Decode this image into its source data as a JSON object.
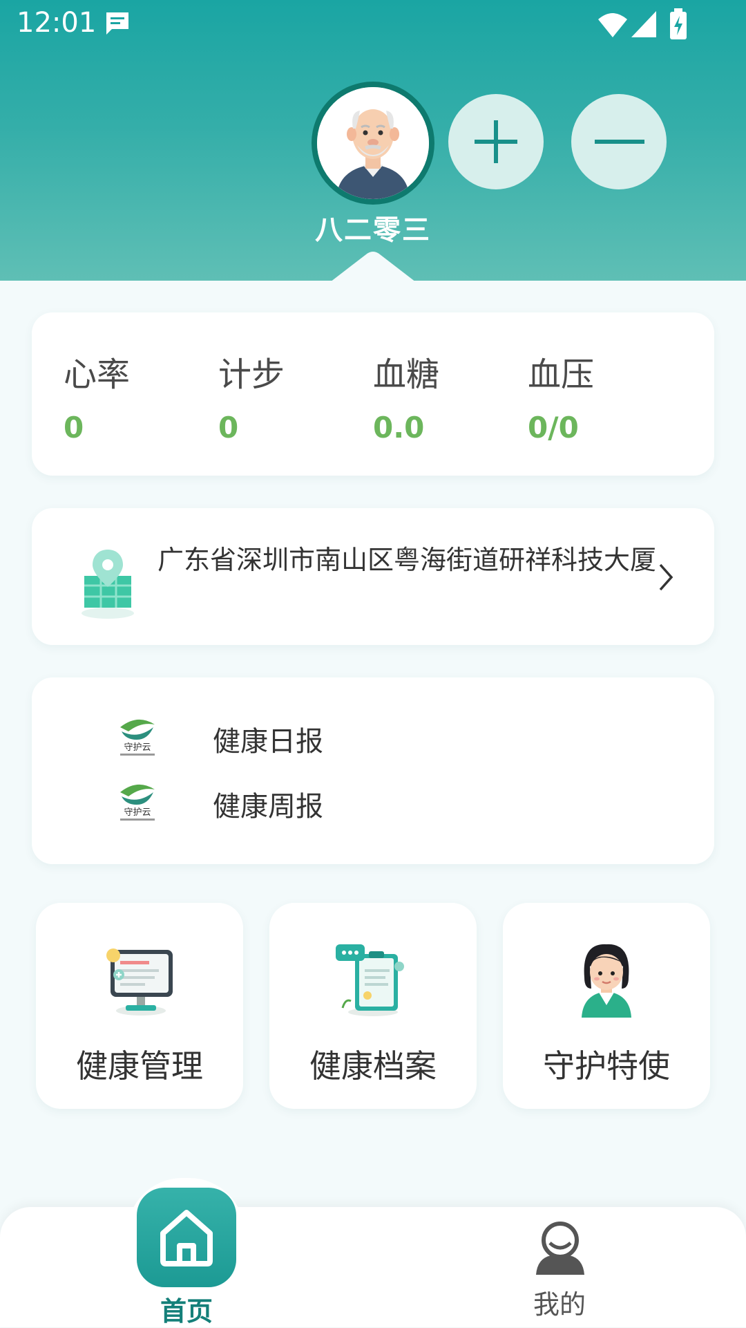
{
  "status_bar": {
    "time": "12:01",
    "icons": [
      "message-icon",
      "wifi-icon",
      "signal-icon",
      "battery-charging-icon"
    ]
  },
  "profile": {
    "name": "八二零三",
    "avatar_icon": "elderly-man-avatar",
    "add_icon": "plus-icon",
    "remove_icon": "minus-icon"
  },
  "vitals": [
    {
      "label": "心率",
      "value": "0"
    },
    {
      "label": "计步",
      "value": "0"
    },
    {
      "label": "血糖",
      "value": "0.0"
    },
    {
      "label": "血压",
      "value": "0/0"
    }
  ],
  "location": {
    "address": "广东省深圳市南山区粤海街道研祥科技大厦",
    "icon": "map-pin-icon"
  },
  "reports": [
    {
      "label": "健康日报",
      "logo_text": "守护云"
    },
    {
      "label": "健康周报",
      "logo_text": "守护云"
    }
  ],
  "tiles": [
    {
      "label": "健康管理",
      "icon": "health-monitor-icon"
    },
    {
      "label": "健康档案",
      "icon": "health-record-icon"
    },
    {
      "label": "守护特使",
      "icon": "guardian-agent-icon"
    }
  ],
  "nav": {
    "home_label": "首页",
    "mine_label": "我的"
  },
  "colors": {
    "header_top": "#1aa5a3",
    "accent": "#1c9a94",
    "vital_value": "#6cb65c"
  }
}
